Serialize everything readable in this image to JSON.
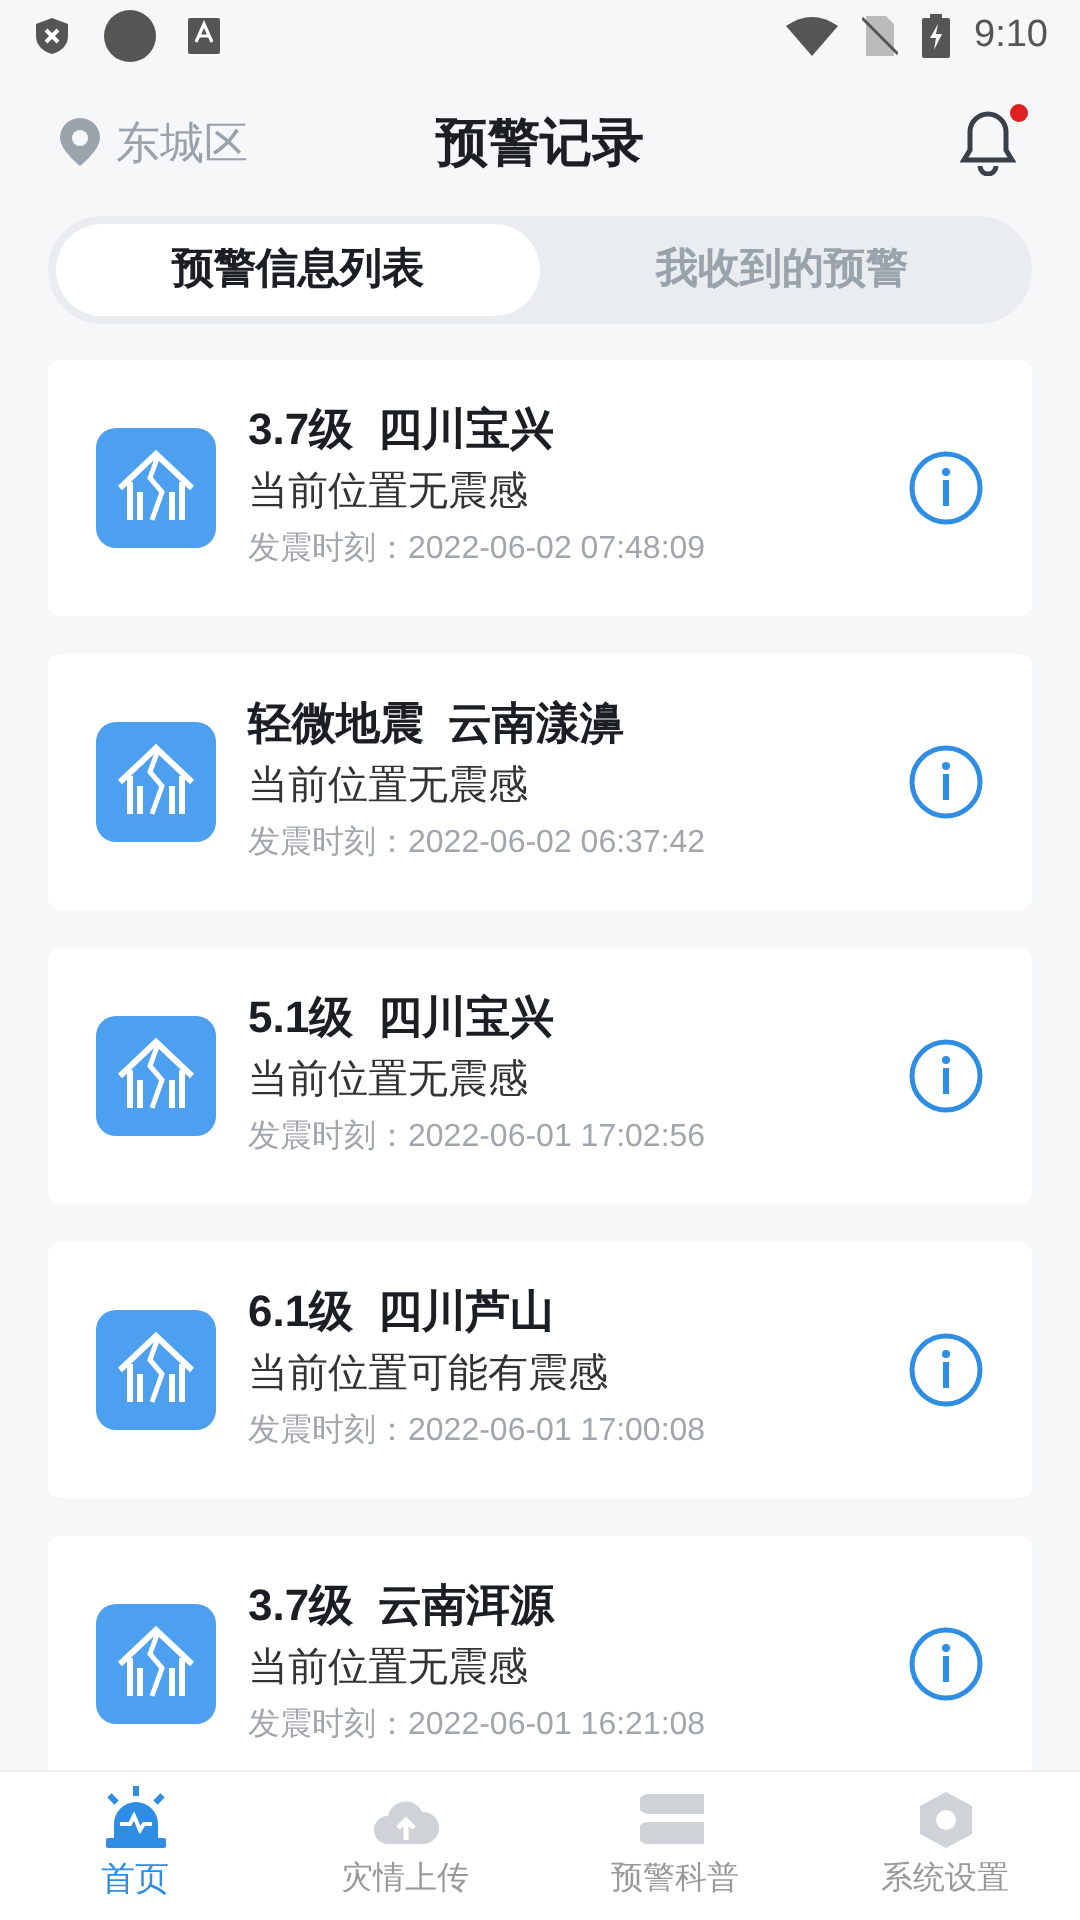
{
  "status_bar": {
    "time": "9:10"
  },
  "header": {
    "location": "东城区",
    "title": "预警记录",
    "notification_dot": true
  },
  "tabs": [
    {
      "label": "预警信息列表",
      "selected": true
    },
    {
      "label": "我收到的预警",
      "selected": false
    }
  ],
  "records": [
    {
      "title": "3.7级  四川宝兴",
      "feeling": "当前位置无震感",
      "time": "发震时刻：2022-06-02 07:48:09"
    },
    {
      "title": "轻微地震  云南漾濞",
      "feeling": "当前位置无震感",
      "time": "发震时刻：2022-06-02 06:37:42"
    },
    {
      "title": "5.1级  四川宝兴",
      "feeling": "当前位置无震感",
      "time": "发震时刻：2022-06-01 17:02:56"
    },
    {
      "title": "6.1级  四川芦山",
      "feeling": "当前位置可能有震感",
      "time": "发震时刻：2022-06-01 17:00:08"
    },
    {
      "title": "3.7级  云南洱源",
      "feeling": "当前位置无震感",
      "time": "发震时刻：2022-06-01 16:21:08"
    }
  ],
  "bottom_nav": [
    {
      "label": "首页",
      "kind": "alarm",
      "selected": true
    },
    {
      "label": "灾情上传",
      "kind": "upload",
      "selected": false
    },
    {
      "label": "预警科普",
      "kind": "book",
      "selected": false
    },
    {
      "label": "系统设置",
      "kind": "settings",
      "selected": false
    }
  ]
}
